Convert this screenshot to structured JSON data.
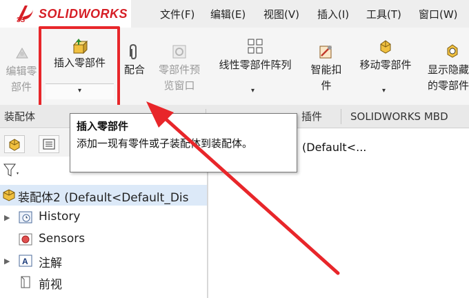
{
  "app": {
    "brand_ds": "3S",
    "brand_name": "SOLIDWORKS"
  },
  "menu": [
    "文件(F)",
    "编辑(E)",
    "视图(V)",
    "插入(I)",
    "工具(T)",
    "窗口(W)"
  ],
  "ribbon": {
    "edit_component": {
      "line1": "编辑零",
      "line2": "部件",
      "enabled": false
    },
    "insert_components": {
      "label": "插入零部件",
      "dropdown": "▾"
    },
    "mate": {
      "label": "配合"
    },
    "component_preview": {
      "line1": "零部件预",
      "line2": "览窗口",
      "enabled": false
    },
    "linear_pattern": {
      "label": "线性零部件阵列",
      "dropdown": "▾"
    },
    "smart_fasteners": {
      "line1": "智能扣",
      "line2": "件"
    },
    "move_component": {
      "label": "移动零部件",
      "dropdown": "▾"
    },
    "show_hidden": {
      "line1": "显示隐藏",
      "line2": "的零部件"
    }
  },
  "tabs": [
    "装配体",
    "插件",
    "SOLIDWORKS MBD"
  ],
  "tooltip": {
    "title": "插入零部件",
    "description": "添加一现有零件或子装配体到装配体。"
  },
  "tree": {
    "root": "装配体2  (Default<Default_Dis",
    "items": [
      "History",
      "Sensors",
      "注解",
      "前视"
    ]
  },
  "right_panel": {
    "text": "(Default<..."
  },
  "colors": {
    "highlight": "#e8262a",
    "brand": "#d61f26",
    "selection": "#dce9f8"
  }
}
